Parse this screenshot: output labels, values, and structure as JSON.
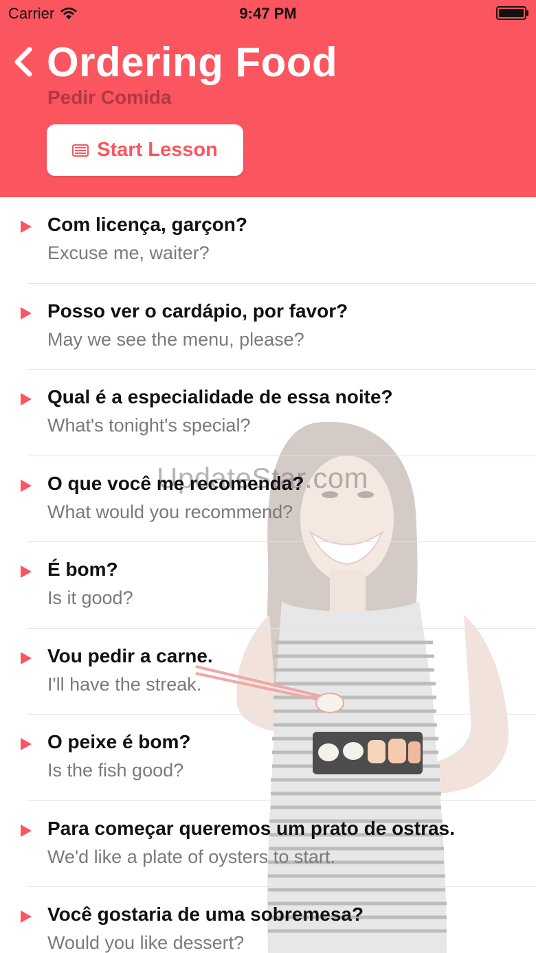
{
  "status_bar": {
    "carrier": "Carrier",
    "time": "9:47 PM"
  },
  "header": {
    "title": "Ordering Food",
    "subtitle": "Pedir Comida",
    "start_button_label": "Start Lesson",
    "accent_color": "#fb555f"
  },
  "watermark": "UpdateStar.com",
  "phrases": [
    {
      "phrase": "Com licença, garçon?",
      "translation": "Excuse me, waiter?"
    },
    {
      "phrase": "Posso ver o cardápio, por favor?",
      "translation": "May we see the menu, please?"
    },
    {
      "phrase": "Qual é a especialidade de essa noite?",
      "translation": "What's tonight's special?"
    },
    {
      "phrase": "O que você me recomenda?",
      "translation": "What would you recommend?"
    },
    {
      "phrase": "É bom?",
      "translation": "Is it good?"
    },
    {
      "phrase": "Vou pedir a carne.",
      "translation": "I'll have the streak."
    },
    {
      "phrase": "O peixe é bom?",
      "translation": "Is the fish good?"
    },
    {
      "phrase": "Para começar queremos um prato de ostras.",
      "translation": "We'd like a plate of oysters to start."
    },
    {
      "phrase": "Você gostaria de uma sobremesa?",
      "translation": "Would you like dessert?"
    }
  ],
  "icons": {
    "back": "chevron-left-icon",
    "lesson": "list-icon",
    "play": "play-icon"
  }
}
